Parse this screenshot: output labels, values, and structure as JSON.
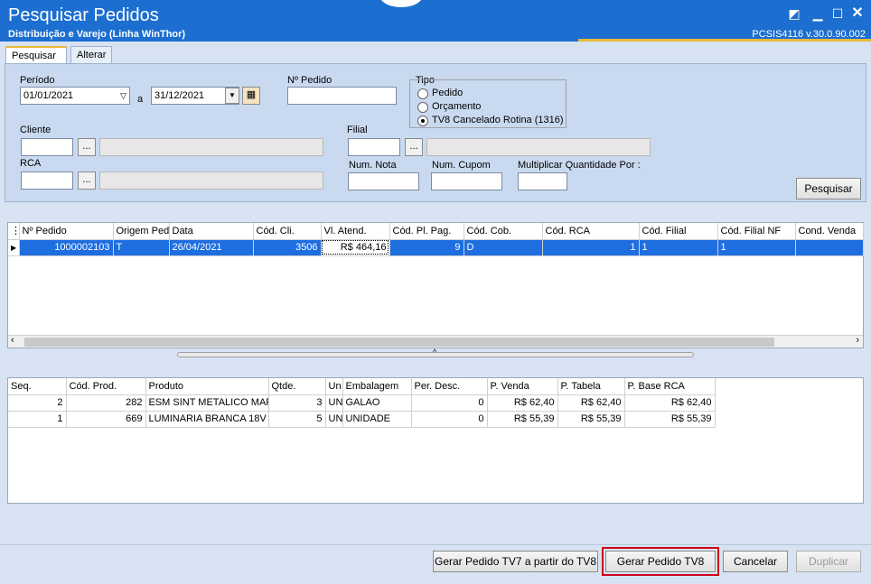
{
  "window": {
    "title": "Pesquisar Pedidos",
    "subtitle": "Distribuição e Varejo (Linha WinThor)",
    "version": "PCSIS4116  v.30.0.90.002"
  },
  "tabs": [
    {
      "label": "Pesquisar"
    },
    {
      "label": "Alterar"
    }
  ],
  "filters": {
    "periodo_label": "Período",
    "periodo_start": "01/01/2021",
    "periodo_sep": "a",
    "periodo_end": "31/12/2021",
    "npedido_label": "Nº Pedido",
    "npedido_value": "",
    "tipo_label": "Tipo",
    "tipo_options": [
      "Pedido",
      "Orçamento",
      "TV8 Cancelado Rotina (1316)"
    ],
    "cliente_label": "Cliente",
    "filial_label": "Filial",
    "rca_label": "RCA",
    "num_nota_label": "Num. Nota",
    "num_cupom_label": "Num. Cupom",
    "multiplicar_label": "Multiplicar Quantidade Por :",
    "ellipsis": "...",
    "pesquisar_button": "Pesquisar"
  },
  "orders_grid": {
    "columns": [
      "Nº Pedido",
      "Origem Ped.",
      "Data",
      "Cód. Cli.",
      "Vl. Atend.",
      "Cód. Pl. Pag.",
      "Cód. Cob.",
      "Cód. RCA",
      "Cód. Filial",
      "Cód. Filial NF",
      "Cond. Venda"
    ],
    "rows": [
      [
        "1000002103",
        "T",
        "26/04/2021",
        "3506",
        "R$ 464,16",
        "9",
        "D",
        "1",
        "1",
        "1",
        ""
      ]
    ]
  },
  "items_grid": {
    "columns": [
      "Seq.",
      "Cód. Prod.",
      "Produto",
      "Qtde.",
      "Un",
      "Embalagem",
      "Per. Desc.",
      "P. Venda",
      "P. Tabela",
      "P. Base RCA"
    ],
    "rows": [
      [
        "2",
        "282",
        "ESM SINT METALICO MARR",
        "3",
        "UN",
        "GALAO",
        "0",
        "R$ 62,40",
        "R$ 62,40",
        "R$ 62,40"
      ],
      [
        "1",
        "669",
        "LUMINARIA BRANCA 18V",
        "5",
        "UN",
        "UNIDADE",
        "0",
        "R$ 55,39",
        "R$ 55,39",
        "R$ 55,39"
      ]
    ]
  },
  "footer": {
    "gerar_tv7": "Gerar Pedido TV7 a partir do TV8",
    "gerar_tv8": "Gerar Pedido TV8",
    "cancelar": "Cancelar",
    "duplicar": "Duplicar"
  },
  "colors": {
    "titlebar": "#1c6fd0",
    "selection": "#1e6ee0",
    "highlight_border": "#d0021b",
    "accent": "#e8b73a"
  }
}
